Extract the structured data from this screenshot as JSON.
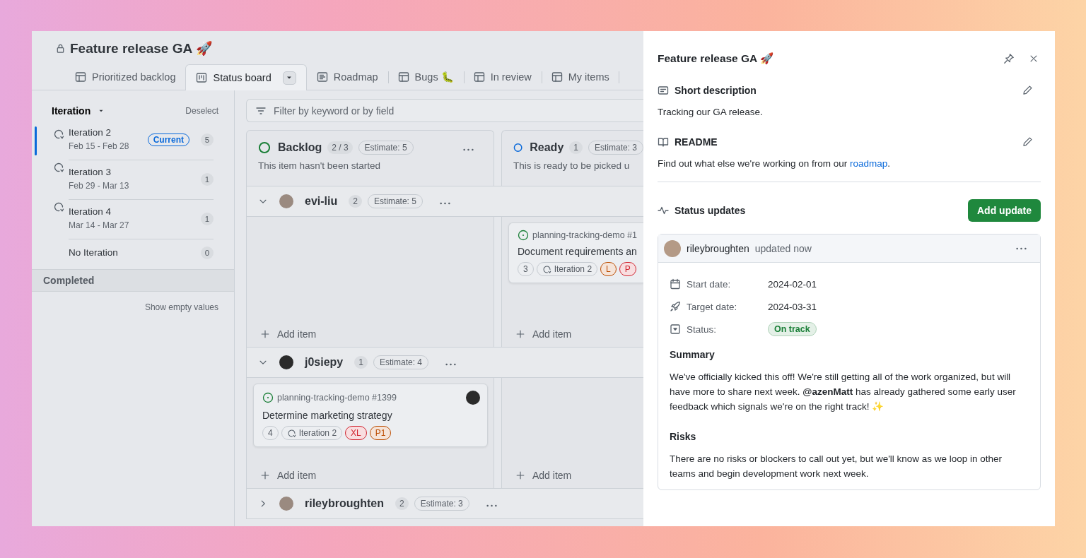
{
  "project": {
    "title": "Feature release GA 🚀"
  },
  "tabs": [
    {
      "label": "Prioritized backlog",
      "kind": "table",
      "selected": false,
      "menu": false
    },
    {
      "label": "Status board",
      "kind": "board",
      "selected": true,
      "menu": true
    },
    {
      "label": "Roadmap",
      "kind": "roadmap",
      "selected": false,
      "menu": false
    },
    {
      "label": "Bugs 🐛",
      "kind": "table",
      "selected": false,
      "menu": false
    },
    {
      "label": "In review",
      "kind": "table",
      "selected": false,
      "menu": false
    },
    {
      "label": "My items",
      "kind": "table",
      "selected": false,
      "menu": false
    }
  ],
  "sidebar": {
    "field": "Iteration",
    "deselect": "Deselect",
    "items": [
      {
        "kind": "iteration",
        "name": "Iteration 2",
        "dates": "Feb 15 - Feb 28",
        "badge": "Current",
        "count": "5",
        "selected": true
      },
      {
        "kind": "iteration",
        "name": "Iteration 3",
        "dates": "Feb 29 - Mar 13",
        "count": "1",
        "selected": false
      },
      {
        "kind": "iteration",
        "name": "Iteration 4",
        "dates": "Mar 14 - Mar 27",
        "count": "1",
        "selected": false
      },
      {
        "kind": "none",
        "name": "No Iteration",
        "count": "0",
        "selected": false
      }
    ],
    "completed": "Completed",
    "show_empty": "Show empty values"
  },
  "filter": {
    "placeholder": "Filter by keyword or by field"
  },
  "columns": [
    {
      "name": "Backlog",
      "count": "2 / 3",
      "estimate": "Estimate: 5",
      "description": "This item hasn't been started",
      "color": "#1a7f37"
    },
    {
      "name": "Ready",
      "count": "1",
      "estimate": "Estimate: 3",
      "description": "This is ready to be picked u",
      "color": "#0969da"
    }
  ],
  "groups": [
    {
      "user": "evi-liu",
      "count": "2",
      "estimate": "Estimate: 5",
      "expanded": true,
      "cells": [
        {
          "add": "Add item"
        },
        {
          "cards": [
            {
              "repo": "planning-tracking-demo #1",
              "title": "Document requirements an",
              "assignee": false,
              "tags": [
                {
                  "kind": "number",
                  "label": "3"
                },
                {
                  "kind": "iteration",
                  "label": "Iteration 2"
                },
                {
                  "kind": "label",
                  "label": "L",
                  "color": "#bc4c00"
                },
                {
                  "kind": "label",
                  "label": "P",
                  "color": "#d1242f"
                }
              ]
            }
          ],
          "add": "Add item"
        }
      ]
    },
    {
      "user": "j0siepy",
      "count": "1",
      "estimate": "Estimate: 4",
      "expanded": true,
      "cells": [
        {
          "cards": [
            {
              "repo": "planning-tracking-demo #1399",
              "title": "Determine marketing strategy",
              "assignee": true,
              "tags": [
                {
                  "kind": "number",
                  "label": "4"
                },
                {
                  "kind": "iteration",
                  "label": "Iteration 2"
                },
                {
                  "kind": "label",
                  "label": "XL",
                  "color": "#d1242f"
                },
                {
                  "kind": "label",
                  "label": "P1",
                  "color": "#bc4c00"
                }
              ]
            }
          ],
          "add": "Add item"
        },
        {
          "add": "Add item"
        }
      ]
    },
    {
      "user": "rileybroughten",
      "count": "2",
      "estimate": "Estimate: 3",
      "expanded": false
    }
  ],
  "panel": {
    "title": "Feature release GA 🚀",
    "short_description": {
      "heading": "Short description",
      "text": "Tracking our GA release."
    },
    "readme": {
      "heading": "README",
      "text": "Find out what else we're working on from our ",
      "link": "roadmap",
      "text_after": "."
    },
    "status_updates": {
      "heading": "Status updates",
      "button": "Add update",
      "update": {
        "author": "rileybroughten",
        "time": "updated now",
        "fields": [
          {
            "kind": "start",
            "label": "Start date:",
            "value": "2024-02-01"
          },
          {
            "kind": "target",
            "label": "Target date:",
            "value": "2024-03-31"
          },
          {
            "kind": "status",
            "label": "Status:",
            "value": "On track",
            "color": "#1a7f37"
          }
        ],
        "sections": [
          {
            "heading": "Summary",
            "text": "We've officially kicked this off! We're still getting all of the work organized, but will have more to share next week. **@azenMatt** has already gathered some early user feedback which signals we're on the right track! ✨"
          },
          {
            "heading": "Risks",
            "text": "There are no risks or blockers to call out yet, but we'll know as we loop in other teams and begin development work next week."
          }
        ]
      }
    }
  }
}
